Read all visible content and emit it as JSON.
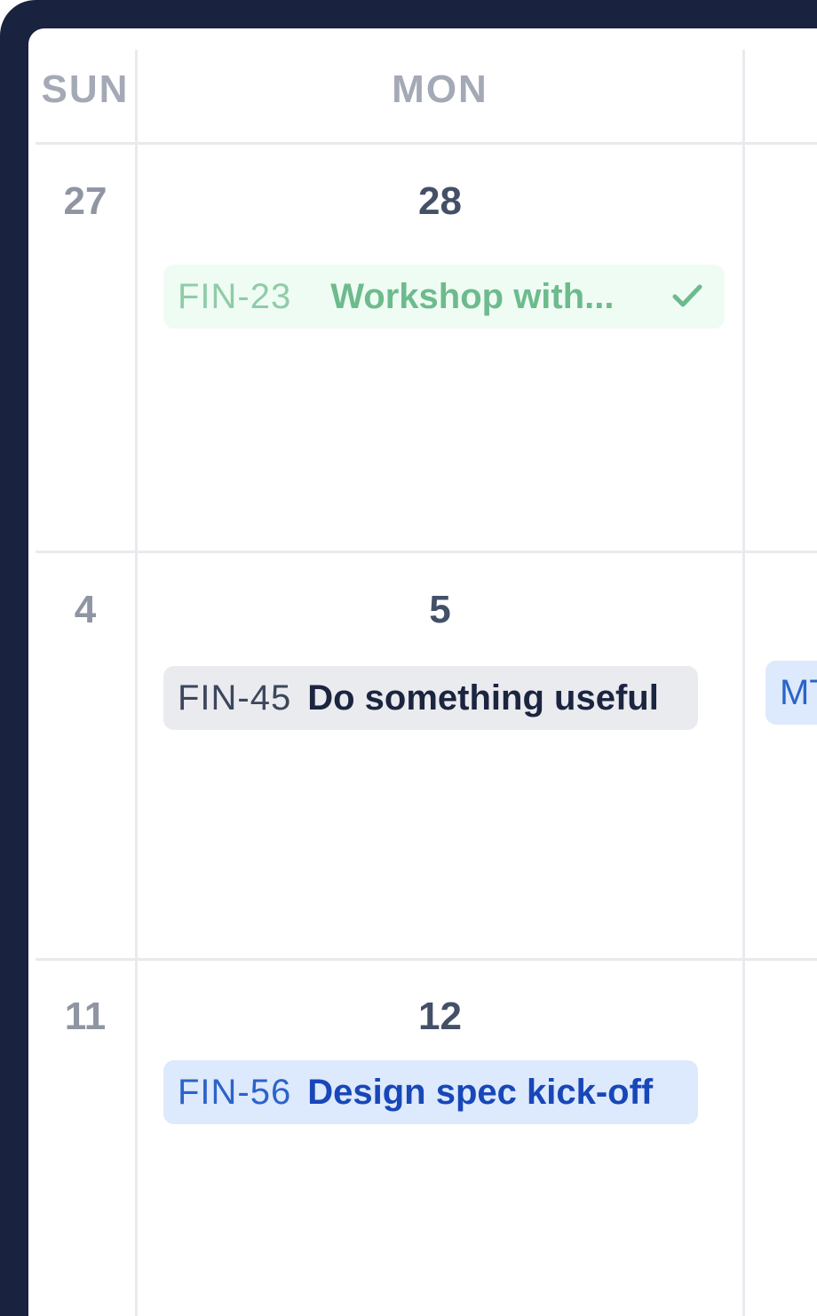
{
  "calendar": {
    "headers": {
      "sun": "SUN",
      "mon": "MON"
    },
    "weeks": [
      {
        "sun_date": "27",
        "mon_date": "28",
        "event": {
          "code": "FIN-23",
          "title": "Workshop with...",
          "status_icon": "check-icon",
          "color": "#6dbb8d"
        }
      },
      {
        "sun_date": "4",
        "mon_date": "5",
        "event": {
          "code": "FIN-45",
          "title": "Do something useful",
          "color": "#1b2540"
        },
        "next_col_event": {
          "code_partial": "MT"
        }
      },
      {
        "sun_date": "11",
        "mon_date": "12",
        "event": {
          "code": "FIN-56",
          "title": "Design spec kick-off",
          "color": "#1747b8"
        }
      }
    ]
  }
}
